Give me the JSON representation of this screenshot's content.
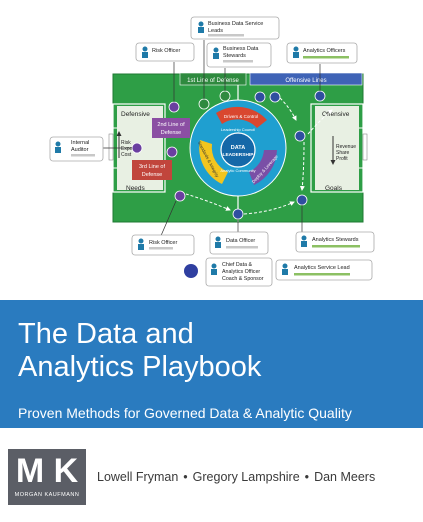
{
  "cover": {
    "title_line1": "The Data and",
    "title_line2": "Analytics Playbook",
    "subtitle": "Proven Methods for Governed Data & Analytic Quality",
    "authors": [
      "Lowell Fryman",
      "Gregory Lampshire",
      "Dan Meers"
    ],
    "separator": "•",
    "publisher_mark": "M K",
    "publisher_name": "MORGAN KAUFMANN",
    "band_color": "#2a7bbf"
  },
  "diagram": {
    "roles": {
      "business_data_service_leads": [
        "Business Data Service",
        "Leads"
      ],
      "risk_officer_top": "Risk Officer",
      "business_data_stewards": [
        "Business Data",
        "Stewards"
      ],
      "analytics_officers": "Analytics Officers",
      "internal_auditor": [
        "Internal",
        "Auditor"
      ],
      "risk_officer_bottom": "Risk Officer",
      "data_officer": "Data Officer",
      "chief_data_officer": [
        "Chief Data &",
        "Analytics Officer",
        "Coach & Sponsor"
      ],
      "analytics_stewards": "Analytics Stewards",
      "analytics_service_lead": "Analytics Service Lead"
    },
    "field": {
      "first_line": "1st Line of Defense",
      "offensive_lines": "Offensive Lines",
      "defensive": "Defensive",
      "offensive": "Offensive",
      "second_line": [
        "2nd Line of",
        "Defense"
      ],
      "third_line": [
        "3rd Line of",
        "Defense"
      ],
      "risk_exposure_cost": [
        "Risk",
        "Exposure",
        "Cost"
      ],
      "revenue_share_profit": [
        "Revenue",
        "Share",
        "Profit"
      ],
      "needs": "Needs",
      "goals": "Goals",
      "center": [
        "DATA",
        "LEADERSHIP"
      ],
      "wheel": {
        "drivers": "Drivers & Control",
        "standards": "Standards & Integrity",
        "deploy": "Deploy & Leverage",
        "council": "Leadership Council",
        "community": "Analytic Community"
      }
    }
  }
}
